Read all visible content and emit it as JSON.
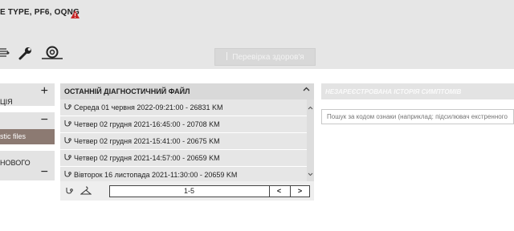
{
  "header": {
    "vehicle_title": "E TYPE, PF6, OQNG"
  },
  "toolbar": {
    "health_check_label": "Перевірка здоров'я"
  },
  "left_panel": {
    "section1_label": "ЦІЯ",
    "selected_item_label": "stic files",
    "section3_label": "НОВОГО"
  },
  "diagnostics": {
    "title": "ОСТАННІЙ ДІАГНОСТИЧНИЙ ФАЙЛ",
    "rows": [
      "Середа 01 червня 2022-09:21:00 - 26831 KM",
      "Четвер 02 грудня 2021-16:45:00 - 20708 KM",
      "Четвер 02 грудня 2021-15:41:00 - 20675 KM",
      "Четвер 02 грудня 2021-14:57:00 - 20659 KM",
      "Вівторок 16 листопада 2021-11:30:00 - 20659 KM"
    ],
    "pager_label": "1-5",
    "prev_label": "<",
    "next_label": ">"
  },
  "symptoms": {
    "title": "НЕЗАРЕЄСТРОВАНА ІСТОРІЯ СИМПТОМІВ",
    "search_placeholder": "Пошук за кодом ознаки (наприклад: підсилювач екстренного"
  },
  "colors": {
    "warning": "#c62828",
    "selected_item": "#8c7a72"
  }
}
